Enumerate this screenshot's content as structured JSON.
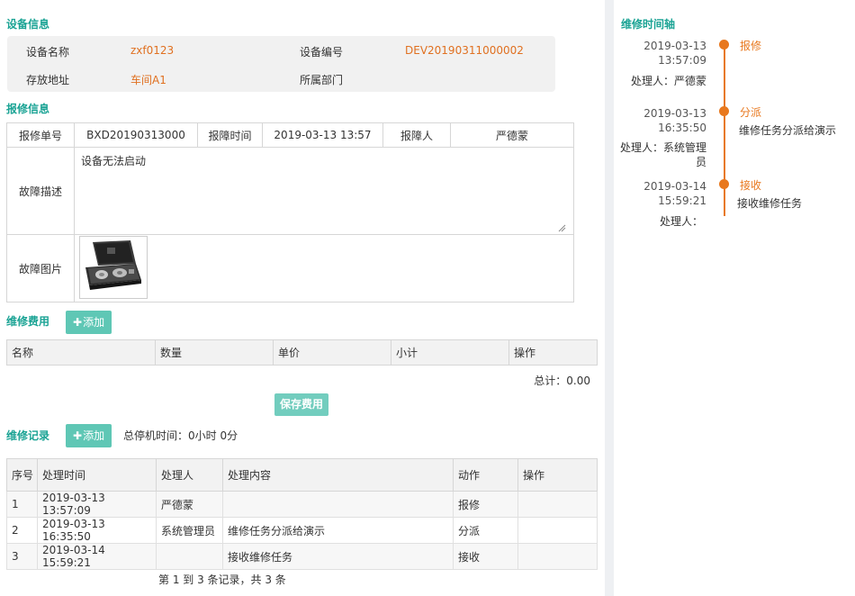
{
  "device_info": {
    "section_title": "设备信息",
    "name_label": "设备名称",
    "name_value": "zxf0123",
    "code_label": "设备编号",
    "code_value": "DEV20190311000002",
    "location_label": "存放地址",
    "location_value": "车间A1",
    "dept_label": "所属部门",
    "dept_value": ""
  },
  "repair_info": {
    "section_title": "报修信息",
    "order_label": "报修单号",
    "order_value": "BXD20190313000",
    "time_label": "报障时间",
    "time_value": "2019-03-13 13:57",
    "reporter_label": "报障人",
    "reporter_value": "严德蒙",
    "fault_desc_label": "故障描述",
    "fault_desc_value": "设备无法启动",
    "fault_image_label": "故障图片"
  },
  "cost": {
    "section_title": "维修费用",
    "add_label": "添加",
    "columns": [
      "名称",
      "数量",
      "单价",
      "小计",
      "操作"
    ],
    "total_label": "总计：0.00",
    "save_label": "保存费用"
  },
  "records": {
    "section_title": "维修记录",
    "add_label": "添加",
    "downtime_label": "总停机时间：",
    "downtime_value": "0小时 0分",
    "columns": [
      "序号",
      "处理时间",
      "处理人",
      "处理内容",
      "动作",
      "操作"
    ],
    "rows": [
      {
        "no": "1",
        "time": "2019-03-13 13:57:09",
        "handler": "严德蒙",
        "content": "",
        "action": "报修",
        "op": ""
      },
      {
        "no": "2",
        "time": "2019-03-13 16:35:50",
        "handler": "系统管理员",
        "content": "维修任务分派给演示",
        "action": "分派",
        "op": ""
      },
      {
        "no": "3",
        "time": "2019-03-14 15:59:21",
        "handler": "",
        "content": "接收维修任务",
        "action": "接收",
        "op": ""
      }
    ],
    "pagination": "第 1 到 3 条记录，共 3 条"
  },
  "timeline": {
    "title": "维修时间轴",
    "items": [
      {
        "date": "2019-03-13",
        "time": "13:57:09",
        "event": "报修",
        "desc": "",
        "handler_label": "处理人：严德蒙"
      },
      {
        "date": "2019-03-13",
        "time": "16:35:50",
        "event": "分派",
        "desc": "维修任务分派给演示",
        "handler_label": "处理人：系统管理员"
      },
      {
        "date": "2019-03-14",
        "time": "15:59:21",
        "event": "接收",
        "desc": "接收维修任务",
        "handler_label": "处理人："
      }
    ]
  },
  "colors": {
    "accent": "#1aa394",
    "orange": "#e07020",
    "button": "#5fc7b5"
  }
}
